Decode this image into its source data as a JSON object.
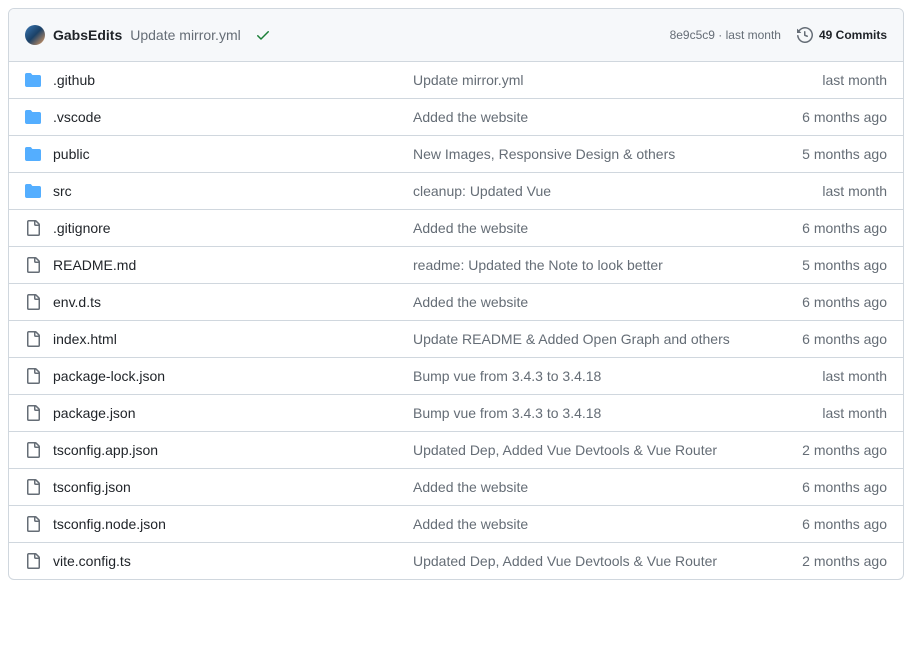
{
  "header": {
    "author": "GabsEdits",
    "commit_message": "Update mirror.yml",
    "commit_sha": "8e9c5c9",
    "commit_when": "last month",
    "separator": " · ",
    "commits_count": "49 Commits"
  },
  "files": [
    {
      "type": "folder",
      "name": ".github",
      "message": "Update mirror.yml",
      "age": "last month"
    },
    {
      "type": "folder",
      "name": ".vscode",
      "message": "Added the website",
      "age": "6 months ago"
    },
    {
      "type": "folder",
      "name": "public",
      "message": "New Images, Responsive Design & others",
      "age": "5 months ago"
    },
    {
      "type": "folder",
      "name": "src",
      "message": "cleanup: Updated Vue",
      "age": "last month"
    },
    {
      "type": "file",
      "name": ".gitignore",
      "message": "Added the website",
      "age": "6 months ago"
    },
    {
      "type": "file",
      "name": "README.md",
      "message": "readme: Updated the Note to look better",
      "age": "5 months ago"
    },
    {
      "type": "file",
      "name": "env.d.ts",
      "message": "Added the website",
      "age": "6 months ago"
    },
    {
      "type": "file",
      "name": "index.html",
      "message": "Update README & Added Open Graph and others",
      "age": "6 months ago"
    },
    {
      "type": "file",
      "name": "package-lock.json",
      "message": "Bump vue from 3.4.3 to 3.4.18",
      "age": "last month"
    },
    {
      "type": "file",
      "name": "package.json",
      "message": "Bump vue from 3.4.3 to 3.4.18",
      "age": "last month"
    },
    {
      "type": "file",
      "name": "tsconfig.app.json",
      "message": "Updated Dep, Added Vue Devtools & Vue Router",
      "age": "2 months ago"
    },
    {
      "type": "file",
      "name": "tsconfig.json",
      "message": "Added the website",
      "age": "6 months ago"
    },
    {
      "type": "file",
      "name": "tsconfig.node.json",
      "message": "Added the website",
      "age": "6 months ago"
    },
    {
      "type": "file",
      "name": "vite.config.ts",
      "message": "Updated Dep, Added Vue Devtools & Vue Router",
      "age": "2 months ago"
    }
  ]
}
